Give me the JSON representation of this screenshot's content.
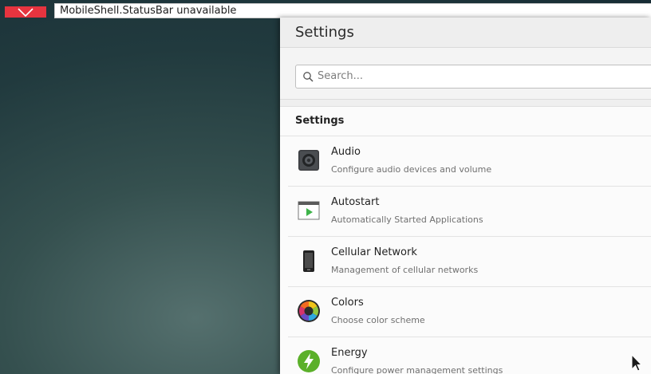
{
  "status_bar": {
    "text": "MobileShell.StatusBar unavailable"
  },
  "window": {
    "title": "Settings"
  },
  "search": {
    "placeholder": "Search..."
  },
  "section": {
    "title": "Settings"
  },
  "items": [
    {
      "title": "Audio",
      "subtitle": "Configure audio devices and volume",
      "icon": "speaker-icon"
    },
    {
      "title": "Autostart",
      "subtitle": "Automatically Started Applications",
      "icon": "autostart-icon"
    },
    {
      "title": "Cellular Network",
      "subtitle": "Management of cellular networks",
      "icon": "phone-icon"
    },
    {
      "title": "Colors",
      "subtitle": "Choose color scheme",
      "icon": "color-wheel-icon"
    },
    {
      "title": "Energy",
      "subtitle": "Configure power management settings",
      "icon": "energy-icon"
    }
  ],
  "colors": {
    "close_button": "#e6343f",
    "energy": "#5bb02a"
  }
}
